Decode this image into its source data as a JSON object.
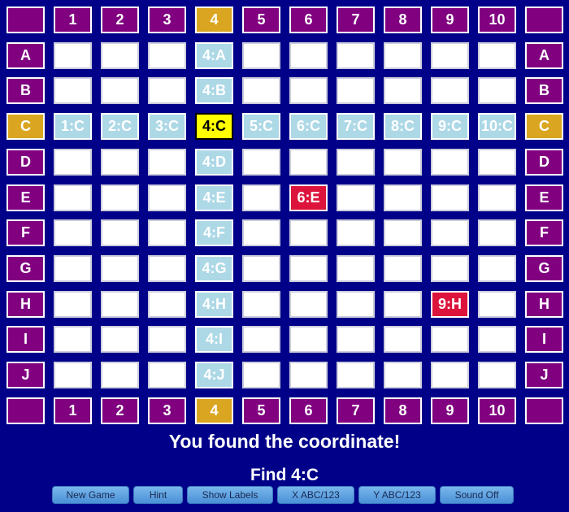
{
  "colors": {
    "background": "#000088",
    "header": "#800080",
    "selected_header": "#DAA520",
    "hint": "#ADD8E6",
    "target": "#FFFF00",
    "wrong": "#DC143C"
  },
  "grid": {
    "columns": [
      "1",
      "2",
      "3",
      "4",
      "5",
      "6",
      "7",
      "8",
      "9",
      "10"
    ],
    "rows": [
      "A",
      "B",
      "C",
      "D",
      "E",
      "F",
      "G",
      "H",
      "I",
      "J"
    ],
    "selected_column": "4",
    "selected_row": "C",
    "target": "4:C",
    "wrong_guesses": [
      "6:E",
      "9:H"
    ],
    "cell_labels": {
      "4:A": "4:A",
      "4:B": "4:B",
      "4:D": "4:D",
      "4:E": "4:E",
      "4:F": "4:F",
      "4:G": "4:G",
      "4:H": "4:H",
      "4:I": "4:I",
      "4:J": "4:J",
      "1:C": "1:C",
      "2:C": "2:C",
      "3:C": "3:C",
      "4:C": "4:C",
      "5:C": "5:C",
      "6:C": "6:C",
      "7:C": "7:C",
      "8:C": "8:C",
      "9:C": "9:C",
      "10:C": "10:C",
      "6:E": "6:E",
      "9:H": "9:H"
    }
  },
  "status": {
    "message": "You found the coordinate!",
    "prompt": "Find 4:C"
  },
  "buttons": [
    {
      "label": "New Game",
      "width": 95
    },
    {
      "label": "Hint",
      "width": 61
    },
    {
      "label": "Show Labels",
      "width": 106
    },
    {
      "label": "X ABC/123",
      "width": 95
    },
    {
      "label": "Y ABC/123",
      "width": 95
    },
    {
      "label": "Sound Off",
      "width": 91
    }
  ]
}
